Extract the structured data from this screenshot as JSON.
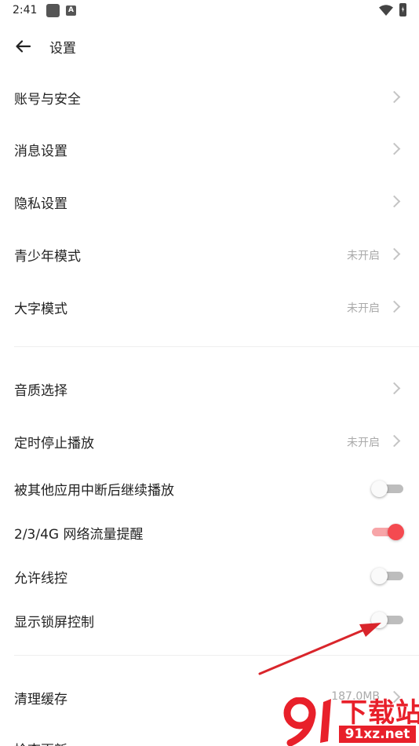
{
  "status_bar": {
    "time": "2:41",
    "notif_letter": "A"
  },
  "header": {
    "title": "设置"
  },
  "sections": {
    "account": {
      "label": "账号与安全"
    },
    "message": {
      "label": "消息设置"
    },
    "privacy": {
      "label": "隐私设置"
    },
    "teen": {
      "label": "青少年模式",
      "value": "未开启"
    },
    "bigfont": {
      "label": "大字模式",
      "value": "未开启"
    },
    "quality": {
      "label": "音质选择"
    },
    "timer": {
      "label": "定时停止播放",
      "value": "未开启"
    },
    "resume": {
      "label": "被其他应用中断后继续播放",
      "toggle": "off"
    },
    "traffic": {
      "label": "2/3/4G 网络流量提醒",
      "toggle": "on"
    },
    "wire": {
      "label": "允许线控",
      "toggle": "off"
    },
    "lockscreen": {
      "label": "显示锁屏控制",
      "toggle": "off"
    },
    "cache": {
      "label": "清理缓存",
      "value": "187.0MB"
    },
    "update": {
      "label": "检查更新"
    }
  },
  "colors": {
    "accent": "#f44a50",
    "annotation_arrow": "#d9252b",
    "watermark": "#e8202a"
  },
  "watermark": {
    "line1": "下载站",
    "line2": "91xz.net"
  }
}
